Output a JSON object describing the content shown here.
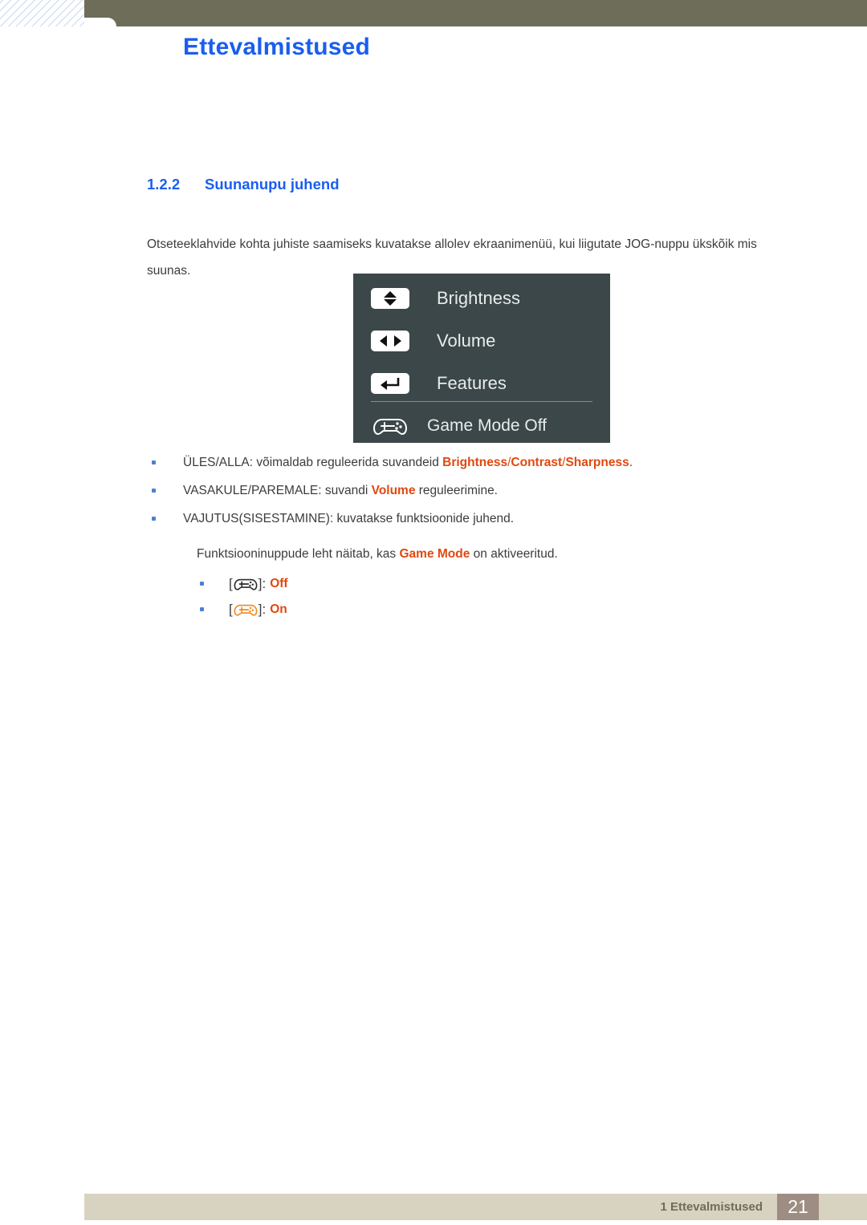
{
  "header": {
    "title": "Ettevalmistused"
  },
  "section": {
    "number": "1.2.2",
    "title": "Suunanupu juhend"
  },
  "intro": "Otseteeklahvide kohta juhiste saamiseks kuvatakse allolev ekraanimenüü, kui liigutate JOG-nuppu ükskõik mis suunas.",
  "osd": {
    "rows": [
      {
        "icon": "up-down-arrow-key-icon",
        "label": "Brightness"
      },
      {
        "icon": "left-right-arrow-key-icon",
        "label": "Volume"
      },
      {
        "icon": "enter-key-icon",
        "label": "Features"
      },
      {
        "icon": "gamepad-icon",
        "label": "Game Mode Off"
      }
    ]
  },
  "bullets": [
    {
      "prefix": "ÜLES/ALLA: võimaldab reguleerida suvandeid ",
      "terms": [
        "Brightness",
        "Contrast",
        "Sharpness"
      ],
      "suffix": "."
    },
    {
      "prefix": "VASAKULE/PAREMALE: suvandi ",
      "terms": [
        "Volume"
      ],
      "suffix": " reguleerimine."
    },
    {
      "prefix": "VAJUTUS(SISESTAMINE): kuvatakse funktsioonide juhend.",
      "terms": [],
      "suffix": ""
    }
  ],
  "subtext": {
    "before": "Funktsiooninuppude leht näitab, kas ",
    "term": "Game Mode",
    "after": " on aktiveeritud."
  },
  "sub_bullets": [
    {
      "icon": "gamepad-icon-off",
      "open": "[",
      "close": "]:",
      "state": "Off",
      "color": "#2b2b2b"
    },
    {
      "icon": "gamepad-icon-on",
      "open": "[",
      "close": "]:",
      "state": "On",
      "color": "#f08a1e"
    }
  ],
  "footer": {
    "label": "1 Ettevalmistused",
    "page": "21"
  },
  "colors": {
    "accent_blue": "#1a5ef0",
    "highlight_orange": "#e1480f",
    "header_olive": "#6d6d59",
    "osd_background": "#3b4749",
    "footer_beige": "#d8d3c0",
    "page_box": "#9e8d82"
  }
}
